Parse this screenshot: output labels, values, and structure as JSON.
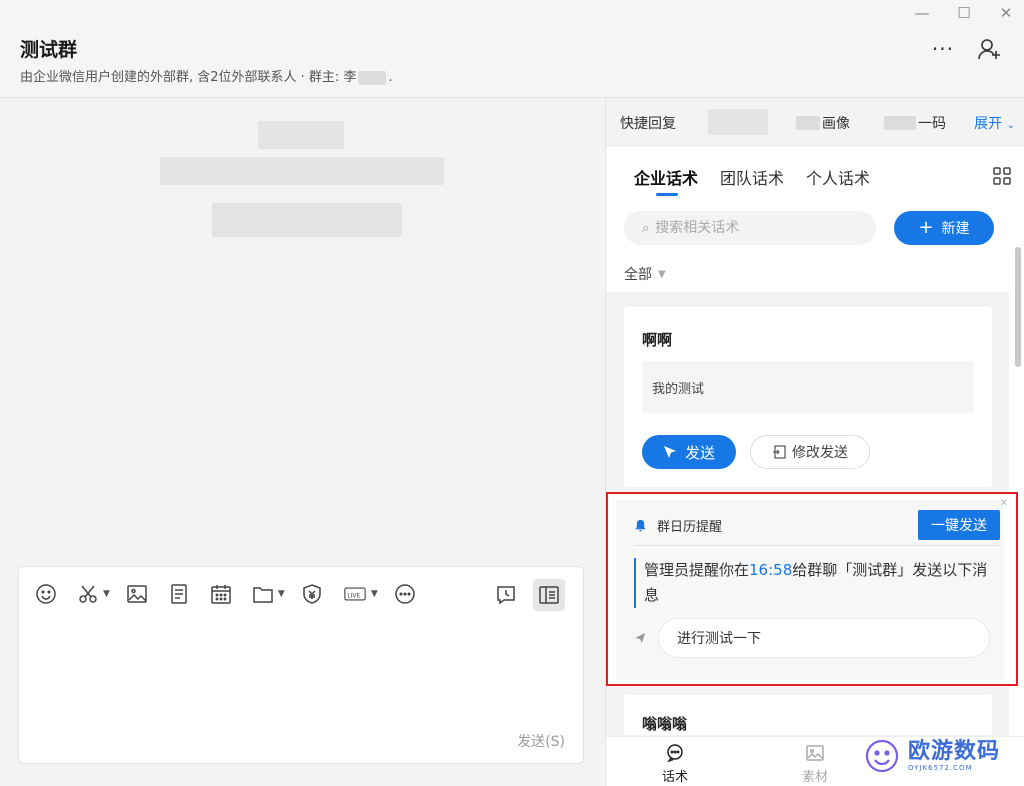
{
  "header": {
    "title": "测试群",
    "subtitle_prefix": "由企业微信用户创建的外部群, 含2位外部联系人 · 群主: 李",
    "subtitle_suffix": "."
  },
  "quick_bar": {
    "item1": "快捷回复",
    "item2_suffix": "画像",
    "item3_suffix": "一码",
    "expand": "展开"
  },
  "tabs": [
    "企业话术",
    "团队话术",
    "个人话术"
  ],
  "search": {
    "placeholder": "搜索相关话术"
  },
  "new_button": "新建",
  "filter": "全部",
  "script_card": {
    "title": "啊啊",
    "content": "我的测试",
    "send": "发送",
    "edit_send": "修改发送"
  },
  "reminder": {
    "title": "群日历提醒",
    "button": "一键发送",
    "text_before": "管理员提醒你在",
    "time": "16:58",
    "text_after": "给群聊「测试群」发送以下消息",
    "message": "进行测试一下"
  },
  "next_card_title": "嗡嗡嗡",
  "bottom_nav": {
    "scripts": "话术",
    "materials": "素材"
  },
  "composer": {
    "send_label": "发送(S)"
  },
  "watermark": {
    "text": "欧游数码",
    "sub": "OYJK6572.COM"
  },
  "colors": {
    "accent": "#1677e5",
    "highlight_border": "#e02020"
  }
}
